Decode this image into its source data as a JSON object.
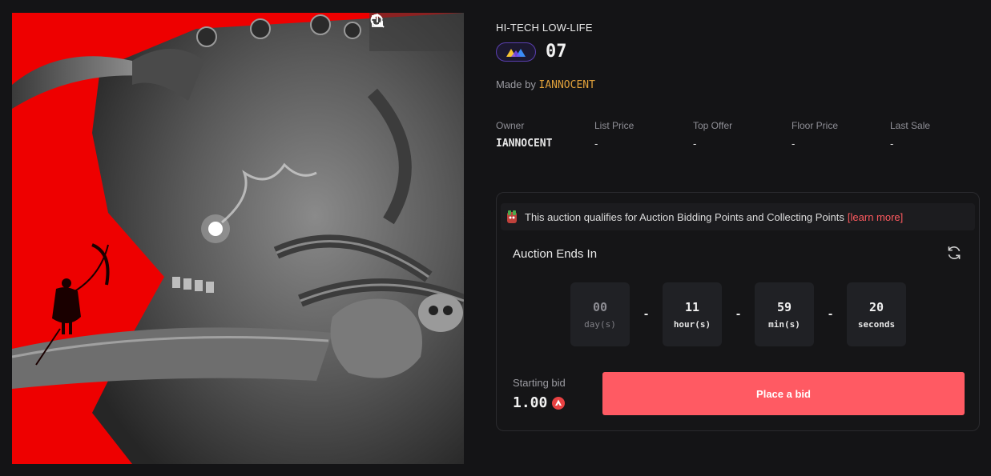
{
  "artwork": {
    "tools": [
      "refresh-icon",
      "search-icon",
      "share-icon"
    ]
  },
  "nft": {
    "collection": "HI-TECH LOW-LIFE",
    "chain_icon": "avalanche-triangles-icon",
    "name": "07",
    "made_by_label": "Made by",
    "creator": "IANNOCENT"
  },
  "stats": [
    {
      "label": "Owner",
      "value": "IANNOCENT"
    },
    {
      "label": "List Price",
      "value": "-"
    },
    {
      "label": "Top Offer",
      "value": "-"
    },
    {
      "label": "Floor Price",
      "value": "-"
    },
    {
      "label": "Last Sale",
      "value": "-"
    }
  ],
  "auction": {
    "notice": "This auction qualifies for Auction Bidding Points and Collecting Points",
    "learn_more": "[learn more]",
    "title": "Auction Ends In",
    "countdown": [
      {
        "value": "00",
        "unit": "day(s)"
      },
      {
        "value": "11",
        "unit": "hour(s)"
      },
      {
        "value": "59",
        "unit": "min(s)"
      },
      {
        "value": "20",
        "unit": "seconds"
      }
    ],
    "separator": "-",
    "starting_bid_label": "Starting bid",
    "starting_bid": "1.00",
    "currency_icon": "avax-icon",
    "place_bid": "Place a bid"
  },
  "colors": {
    "accent": "#ff5a63",
    "creator": "#e0a03a",
    "art_background": "#ee0000"
  }
}
